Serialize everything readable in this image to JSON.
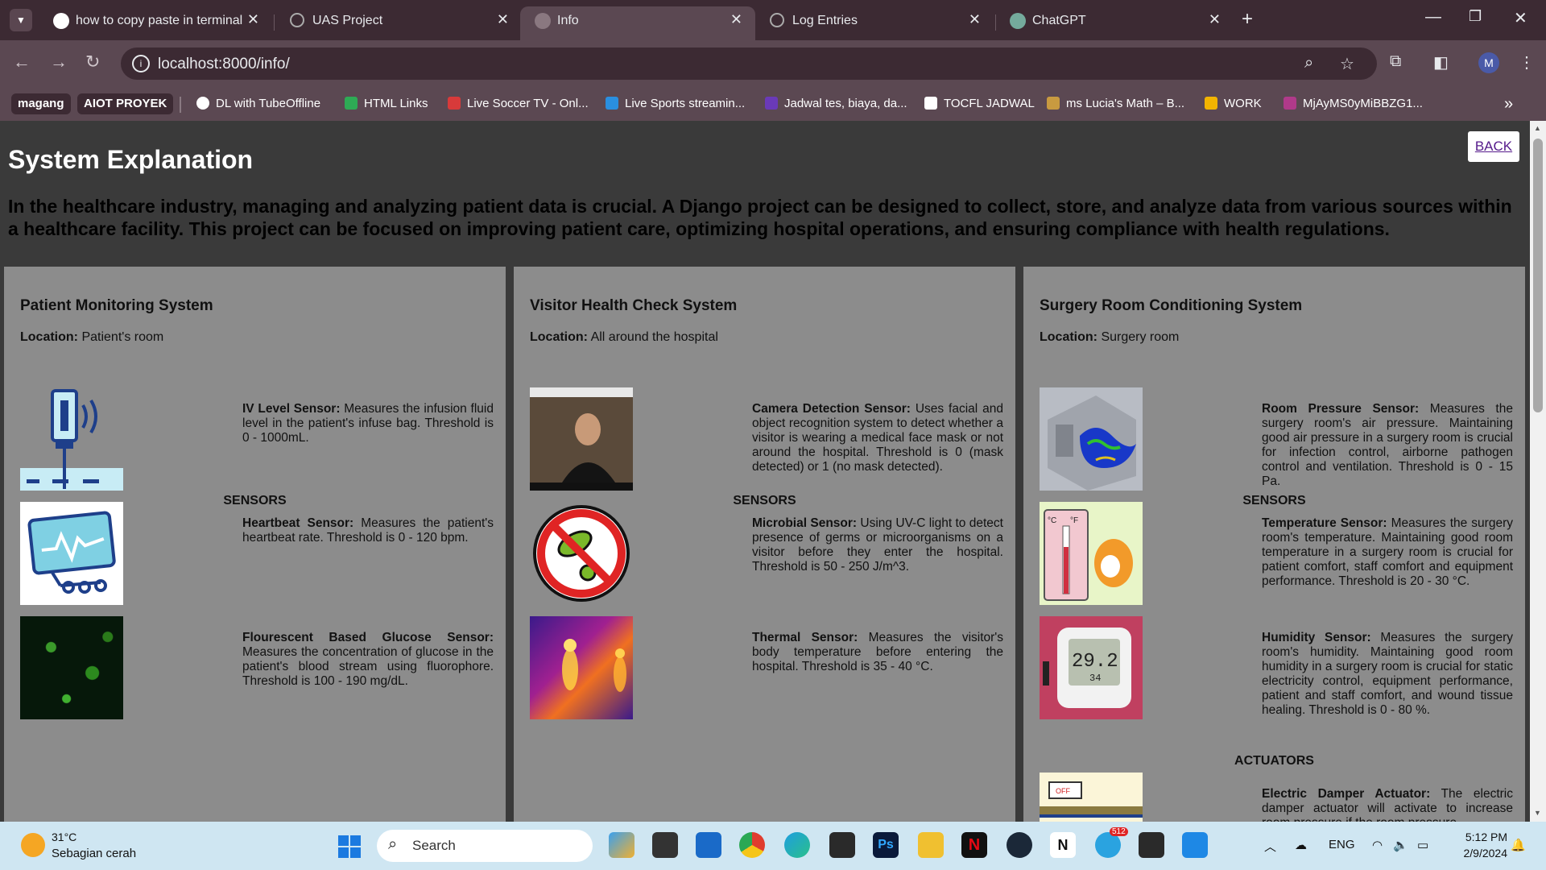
{
  "tabs": [
    {
      "title": "how to copy paste in terminal -",
      "active": false
    },
    {
      "title": "UAS Project",
      "active": false
    },
    {
      "title": "Info",
      "active": true
    },
    {
      "title": "Log Entries",
      "active": false
    },
    {
      "title": "ChatGPT",
      "active": false
    }
  ],
  "address_bar": {
    "url": "localhost:8000/info/"
  },
  "profile_initial": "M",
  "bookmarks": [
    "magang",
    "AIOT PROYEK",
    "DL with TubeOffline",
    "HTML Links",
    "Live Soccer TV - Onl...",
    "Live Sports streamin...",
    "Jadwal tes, biaya, da...",
    "TOCFL JADWAL",
    "ms Lucia's Math – B...",
    "WORK",
    "MjAyMS0yMiBBZG1..."
  ],
  "page": {
    "title": "System Explanation",
    "back_label": "BACK",
    "intro": "In the healthcare industry, managing and analyzing patient data is crucial. A Django project can be designed to collect, store, and analyze data from various sources within a healthcare facility. This project can be focused on improving patient care, optimizing hospital operations, and ensuring compliance with health regulations.",
    "location_label": "Location:",
    "systems": [
      {
        "title": "Patient Monitoring System",
        "location": "Patient's room",
        "sensors_heading": "SENSORS",
        "sensors": [
          {
            "name": "IV Level Sensor:",
            "desc": "Measures the infusion fluid level in the patient's infuse bag. Threshold is 0 - 1000mL.",
            "icon": "iv-bag-icon"
          },
          {
            "name": "Heartbeat Sensor:",
            "desc": "Measures the patient's heartbeat rate. Threshold is 0 - 120 bpm.",
            "icon": "heart-monitor-icon"
          },
          {
            "name": "Flourescent Based Glucose Sensor:",
            "desc": "Measures the concentration of glucose in the patient's blood stream using fluorophore. Threshold is 100 - 190 mg/dL.",
            "icon": "fluorescent-cells-image"
          }
        ]
      },
      {
        "title": "Visitor Health Check System",
        "location": "All around the hospital",
        "sensors_heading": "SENSORS",
        "sensors": [
          {
            "name": "Camera Detection Sensor:",
            "desc": "Uses facial and object recognition system to detect whether a visitor is wearing a medical face mask or not around the hospital. Threshold is 0 (mask detected) or 1 (no mask detected).",
            "icon": "camera-capture-image"
          },
          {
            "name": "Microbial Sensor:",
            "desc": "Using UV-C light to detect presence of germs or microorganisms on a visitor before they enter the hospital. Threshold is 50 - 250 J/m^3.",
            "icon": "no-germs-icon"
          },
          {
            "name": "Thermal Sensor:",
            "desc": "Measures the visitor's body temperature before entering the hospital. Threshold is 35 - 40 °C.",
            "icon": "thermal-image"
          }
        ]
      },
      {
        "title": "Surgery Room Conditioning System",
        "location": "Surgery room",
        "sensors_heading": "SENSORS",
        "sensors": [
          {
            "name": "Room Pressure Sensor:",
            "desc": "Measures the surgery room's air pressure. Maintaining good air pressure in a surgery room is crucial for infection control, airborne pathogen control and ventilation. Threshold is 0 - 15 Pa.",
            "icon": "airflow-simulation-image"
          },
          {
            "name": "Temperature Sensor:",
            "desc": "Measures the surgery room's temperature. Maintaining good room temperature in a surgery room is crucial for patient comfort, staff comfort and equipment performance. Threshold is 20 - 30 °C.",
            "icon": "thermometer-icon"
          },
          {
            "name": "Humidity Sensor:",
            "desc": "Measures the surgery room's humidity. Maintaining good room humidity in a surgery room is crucial for static electricity control, equipment performance, patient and staff comfort, and wound tissue healing. Threshold is 0 - 80 %.",
            "icon": "hygrometer-image"
          }
        ],
        "actuators_heading": "ACTUATORS",
        "actuators": [
          {
            "name": "Electric Damper Actuator:",
            "desc": "The electric damper actuator will activate to increase room pressure if the room pressure",
            "icon": "damper-image"
          }
        ]
      }
    ],
    "hygrometer_reading": "29.2",
    "hygrometer_sub": "34",
    "thermometer_units": [
      "°C",
      "°F"
    ],
    "damper_label": "OFF"
  },
  "taskbar": {
    "weather_temp": "31°C",
    "weather_desc": "Sebagian cerah",
    "search_label": "Search",
    "language": "ENG",
    "time": "5:12 PM",
    "date": "2/9/2024",
    "telegram_badge": "512"
  }
}
